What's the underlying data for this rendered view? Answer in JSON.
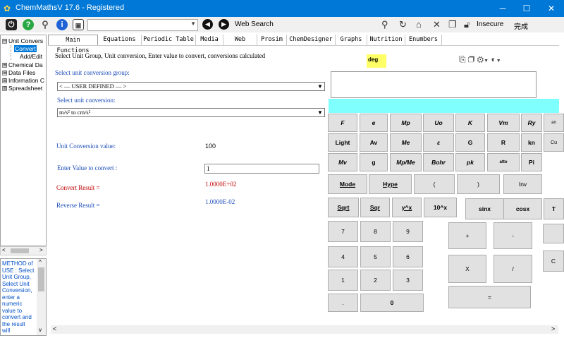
{
  "window": {
    "title": "ChemMathsV 17.6 - Registered",
    "min": "─",
    "max": "☐",
    "close": "✕"
  },
  "toolbar": {
    "web_search": "Web Search",
    "insecure": "Insecure",
    "done": "完成",
    "combo_value": ""
  },
  "sidebar": {
    "items": [
      {
        "box": "⊟",
        "label": "Unit Convers"
      },
      {
        "label": "Convert"
      },
      {
        "label": "Add/Edit"
      },
      {
        "box": "⊞",
        "label": "Chemical Da"
      },
      {
        "box": "⊞",
        "label": "Data Files"
      },
      {
        "box": "⊞",
        "label": "Information C"
      },
      {
        "box": "⊞",
        "label": "Spreadsheet"
      }
    ],
    "help_text": "METHOD of USE : Select Unit Group, Select Unit Conversion, enter a numeric value to convert and the result will"
  },
  "tabs": [
    "Main Functions",
    "Equations",
    "Periodic Table",
    "Media",
    "Web",
    "Prosim",
    "ChemDesigner",
    "Graphs",
    "Nutrition",
    "Enumbers"
  ],
  "main": {
    "instruction": "Select Unit Group, Unit conversion, Enter value to convert, conversions calculated",
    "group_label": "Select unit conversion group:",
    "group_value": "< — USER DEFINED — >",
    "conversion_label": "Select unit conversion:",
    "conversion_value": "m/s² to cm/s²",
    "value_label": "Unit Conversion value:",
    "value": "100",
    "enter_label": "Enter Value to convert :",
    "enter_value": "1",
    "convert_label": "Convert Result =",
    "convert_result": "1.0000E+02",
    "reverse_label": "Reverse Result =",
    "reverse_result": "1.0000E-02"
  },
  "calculator": {
    "deg": "deg",
    "display": "",
    "const_row1": [
      "F",
      "e",
      "Mp",
      "Uo",
      "K",
      "Vm",
      "Ry",
      "an"
    ],
    "const_row2": [
      "Light",
      "Av",
      "Me",
      "ε",
      "G",
      "R",
      "kn",
      "Cu"
    ],
    "const_row3": [
      "Mv",
      "g",
      "Mp/Me",
      "Bohr",
      "pk",
      "atto",
      "Pi"
    ],
    "mode": "Mode",
    "hype": "Hype",
    "lparen": "(",
    "rparen": ")",
    "inv": "Inv",
    "sqrt": "Sqrt",
    "sqr": "Sqr",
    "ypowx": "y^x",
    "tenpowx": "10^x",
    "sinx": "sinx",
    "cosx": "cosx",
    "tan": "T",
    "digits": [
      "7",
      "8",
      "9",
      "4",
      "5",
      "6",
      "1",
      "2",
      "3",
      ".",
      "0"
    ],
    "plus": "+",
    "minus": "-",
    "times": "X",
    "divide": "/",
    "equals": "=",
    "clear": "C"
  }
}
